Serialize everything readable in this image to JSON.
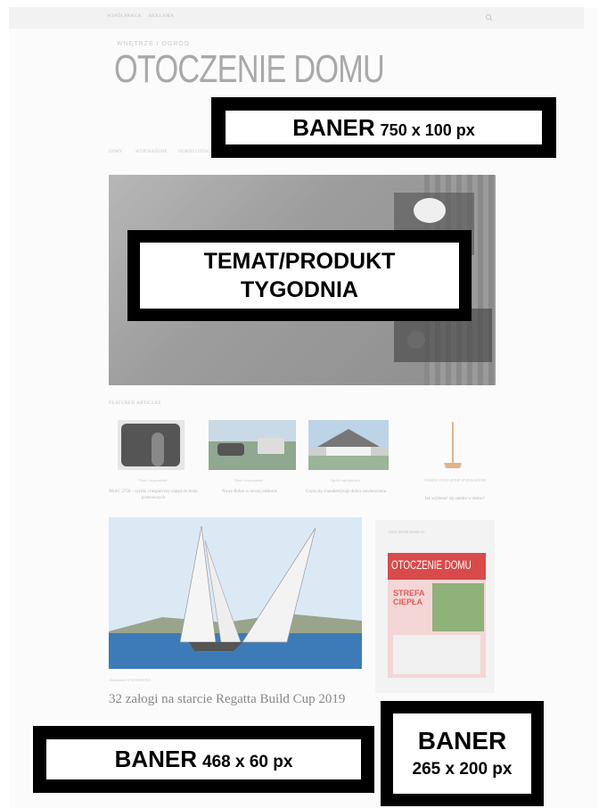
{
  "topbar": {
    "item1": "WSPÓŁPRACA",
    "item2": "REKLAMA"
  },
  "brand": {
    "tagline": "WNĘTRZE I OGRÓD",
    "name": "OTOCZENIE DOMU"
  },
  "nav": [
    "DOMY",
    "WYPOSAŻENIE",
    "OGRÓD I OTOCZENIE"
  ],
  "labels": {
    "top_banner_word": "BANER",
    "top_banner_size": "750 x 100 px",
    "hero_line1": "TEMAT/PRODUKT",
    "hero_line2": "TYGODNIA",
    "bottom_left_word": "BANER",
    "bottom_left_size": "468 x 60 px",
    "bottom_right_word": "BANER",
    "bottom_right_size": "265 x 200 px"
  },
  "featured": {
    "title": "FEATURED ARTICLES",
    "items": [
      {
        "category": "Dom i wyposażenie",
        "title": "PAAC 2750 – szybki i bezpieczny napęd do bram przesuwnych"
      },
      {
        "category": "Dom i wyposażenie",
        "title": "Nowe Robot w nowej odsłonie"
      },
      {
        "category": "Ogród i ogrodnictwo",
        "title": "Czym się charakteryzuje dobra nawierzchnia"
      },
      {
        "category": "OGRÓD I OTOCZENIE WYPOSAŻENIE",
        "title": "Jak wybierać się zamku w domu?"
      }
    ]
  },
  "article": {
    "category": "Aktualności   WYDARZENIA",
    "title": "32 załogi na starcie Regatta Build Cup 2019"
  },
  "sidebar": {
    "title": "OTOCZENIE DOMU #7",
    "magazine_title": "OTOCZENIE DOMU",
    "magazine_cover_line": "STREFA CIEPŁA"
  }
}
